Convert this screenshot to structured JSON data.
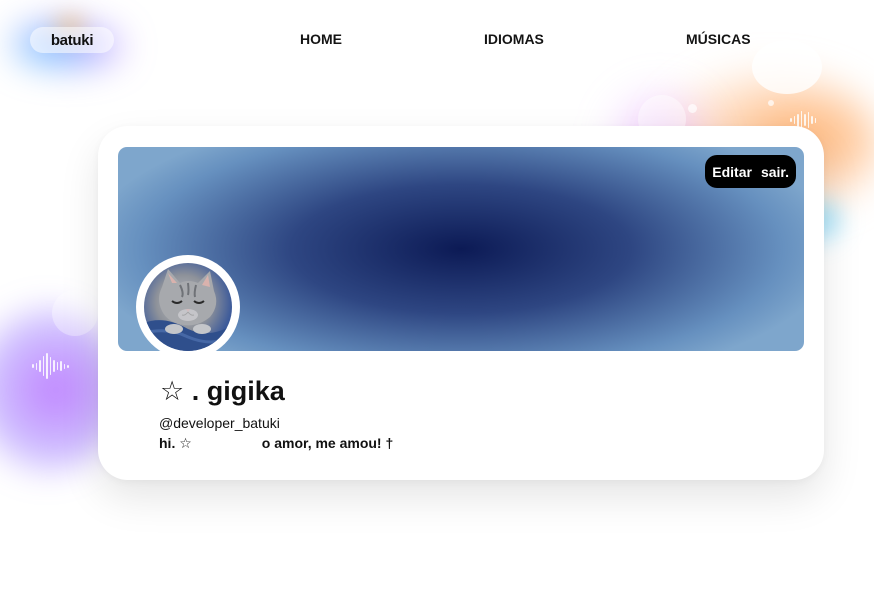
{
  "header": {
    "logo_text": "batuki",
    "nav": [
      {
        "label": "HOME"
      },
      {
        "label": "IDIOMAS"
      },
      {
        "label": "MÚSICAS"
      }
    ]
  },
  "profile": {
    "edit_label": "Editar",
    "logout_label": "sair.",
    "display_name": "☆ . gigika",
    "username": "@developer_batuki",
    "bio": "hi. ☆                  o amor, me amou! †"
  },
  "icons": {
    "logo": "batuki-logo",
    "avatar": "sleeping-cat-avatar",
    "wave": "sound-wave-icon"
  }
}
